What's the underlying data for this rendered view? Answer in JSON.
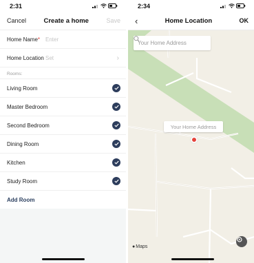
{
  "left_screen": {
    "status_time": "2:31",
    "nav": {
      "cancel_label": "Cancel",
      "title": "Create a home",
      "save_label": "Save"
    },
    "home_name": {
      "label": "Home Name",
      "required_mark": "*",
      "placeholder": "Enter"
    },
    "home_location": {
      "label": "Home Location",
      "value": "Set"
    },
    "rooms_header": "Rooms:",
    "rooms": [
      {
        "name": "Living Room",
        "checked": true
      },
      {
        "name": "Master Bedroom",
        "checked": true
      },
      {
        "name": "Second Bedroom",
        "checked": true
      },
      {
        "name": "Dining Room",
        "checked": true
      },
      {
        "name": "Kitchen",
        "checked": true
      },
      {
        "name": "Study Room",
        "checked": true
      }
    ],
    "add_room_label": "Add Room"
  },
  "right_screen": {
    "status_time": "2:34",
    "nav": {
      "back_icon": "chevron-left-icon",
      "title": "Home Location",
      "ok_label": "OK"
    },
    "search_placeholder": "Your Home Address",
    "pin_label": "Your Home Address",
    "maps_brand": "Maps",
    "locate_icon": "location-target-icon"
  },
  "colors": {
    "accent": "#2d3d5c",
    "required": "#e5423a",
    "pin": "#e5423a",
    "map_background": "#f2efe6",
    "park_green": "#c8dfb7"
  }
}
